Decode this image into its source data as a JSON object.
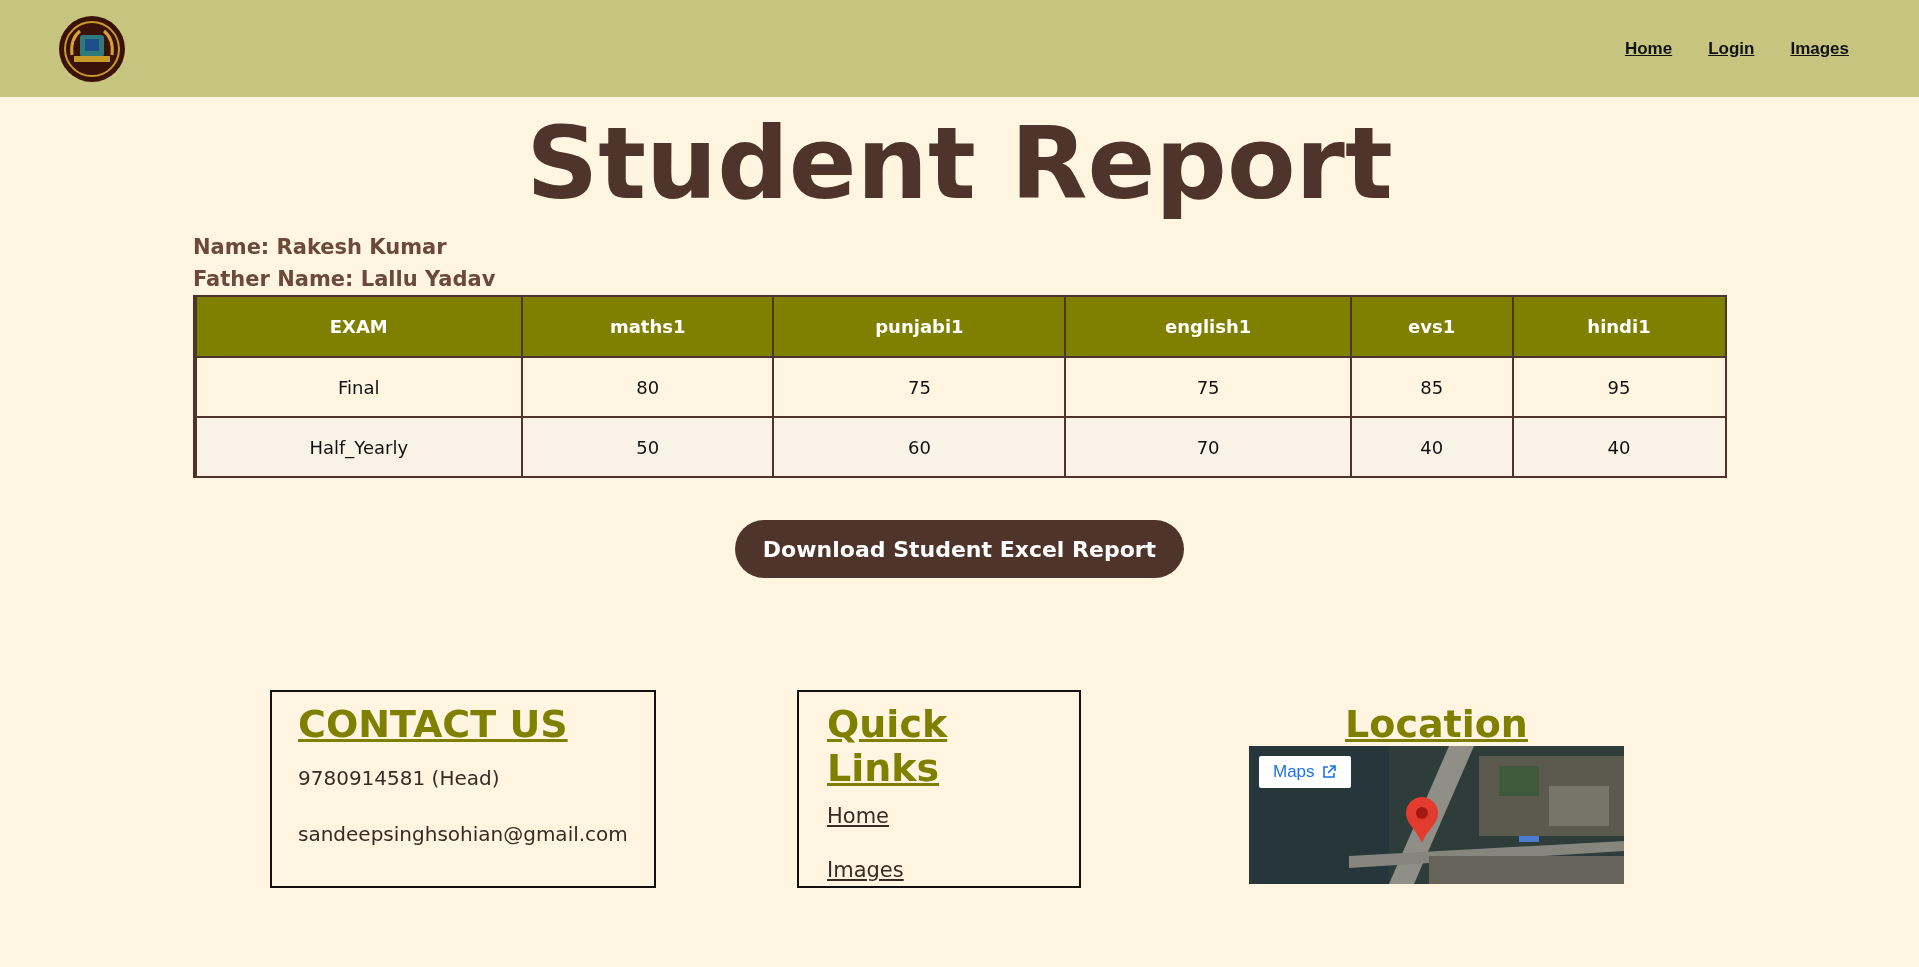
{
  "nav": [
    "Home",
    "Login",
    "Images"
  ],
  "title": "Student Report",
  "student": [
    "Name: Rakesh Kumar",
    "Father Name: Lallu Yadav"
  ],
  "table": {
    "columns": [
      "EXAM",
      "maths1",
      "punjabi1",
      "english1",
      "evs1",
      "hindi1"
    ],
    "rows": [
      [
        "Final",
        "80",
        "75",
        "75",
        "85",
        "95"
      ],
      [
        "Half_Yearly",
        "50",
        "60",
        "70",
        "40",
        "40"
      ]
    ]
  },
  "download_button": "Download Student Excel Report",
  "contact": {
    "heading": "CONTACT US",
    "lines": [
      "9780914581 (Head)",
      "sandeepsinghsohian@gmail.com"
    ]
  },
  "quick_links": {
    "heading": "Quick Links",
    "links": [
      "Home",
      "Images"
    ]
  },
  "location": {
    "heading": "Location",
    "map_button": "Maps"
  }
}
